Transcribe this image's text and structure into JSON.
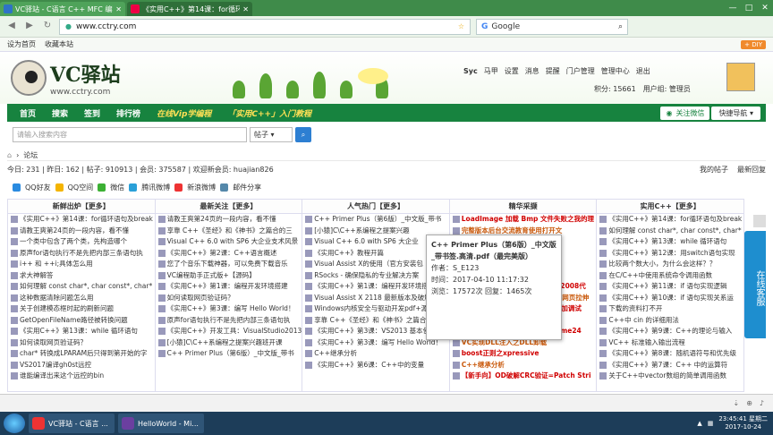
{
  "browser": {
    "tabs": [
      {
        "title": "VC驿站 - C语言 C++ MFC 编程"
      },
      {
        "title": "《实用C++》第14课：for循环语句"
      }
    ],
    "url": "www.cctry.com",
    "search_engine": "Google",
    "bookmarks": [
      "设为首页",
      "收藏本站"
    ],
    "diy_label": "DIY"
  },
  "site": {
    "logo_name": "VC驿站",
    "logo_url": "www.cctry.com",
    "user": {
      "name": "Syc",
      "links": [
        "马甲",
        "设置",
        "消息",
        "提醒",
        "门户管理",
        "管理中心",
        "退出"
      ],
      "credit": "积分: 15661",
      "group": "用户组: 管理员"
    },
    "menu": [
      "首页",
      "搜索",
      "签到",
      "排行榜",
      "在线Vip学编程",
      "「实用C++」入门教程"
    ],
    "wechat": "关注微信",
    "quicknav": "快捷导航",
    "search": {
      "placeholder": "请输入搜索内容",
      "select": "帖子"
    },
    "crumb": "论坛",
    "stats": "今日: 231 | 昨日: 162 | 帖子: 910913 | 会员: 375587 | 欢迎新会员: huajian826",
    "stats_right": [
      "我的帖子",
      "最新回复"
    ],
    "share": [
      "QQ好友",
      "QQ空间",
      "微信",
      "腾讯微博",
      "新浪微博",
      "邮件分享"
    ],
    "columns": [
      {
        "head": "新鲜出炉【更多】",
        "items": [
          "《实用C++》第14课：for循环语句及break",
          "请教王爽第24页的一段内容，看不懂",
          "一个类中包含了两个类，先构造哪个",
          "原声for语句执行不是先把内部三条语句执",
          "i++ 和 ++i;具体怎么用",
          "求大神解答",
          "如何理解 const char*, char const*, char*",
          "这种数据清除问题怎么用",
          "关于创建模态框时起的刷新问题",
          "GetOpenFileName路径被转换问题",
          "《实用C++》第13课：while 循环语句",
          "如何读取网页验证码？",
          "char* 转换成LPARAM后只得到第开始的字",
          "VS2017编译gh0st远控",
          "谁能编译出来这个远控的bin"
        ]
      },
      {
        "head": "最新关注【更多】",
        "items": [
          "请教王爽第24页的一段内容，看不懂",
          "享靠 C++《圣经》和《神书》之篇合的三",
          "Visual C++ 6.0 with SP6 大企业支术风景",
          "《实用C++》第2课：C++语言概述",
          "您了个音乐下载神器，可以免费下载音乐",
          "VC编程助手正式版+【源码】",
          "《实用C++》第1课：编程开发环境搭建",
          "如何读取网页验证码？",
          "《实用C++》第3课：编写 Hello World！",
          "原声for语句执行不是先把内部三条语句执",
          "《实用C++》开发工具：VisualStudio2013",
          "[小猿]C\\C++系编程之提案兴趣班开课",
          "C++ Primer Plus（第6版）_中文版_带书",
          "",
          ""
        ]
      },
      {
        "head": "人气热门【更多】",
        "items": [
          "C++ Primer Plus（第6版）_中文版_带书",
          "[小猿]C\\C++系编程之提案兴趣",
          "Visual C++ 6.0 with SP6 大企业",
          "《实用C++》教程开篇",
          "Visual Assist X的使用（官方安装包",
          "RSocks - 确保隐私的专业解决方案",
          "《实用C++》第1课：编程开发环境搭建",
          "Visual Assist X 2118 最新版本及破解补丁",
          "Windows内核安全与驱动开发pdf+源码 请",
          "享靠 C++《圣经》和《神书》之篇合的三",
          "《实用C++》第3课：VS2013 基本使用",
          "《实用C++》第3课：编写 Hello World！",
          "C++继承分析",
          "《实用C++》第6课：C++中的变量",
          ""
        ]
      },
      {
        "head": "精华采撷",
        "items": [
          "LoadImage 加载 Bmp 文件失败之我的理",
          "完整版本后台交流教育使用打开文",
          "",
          "",
          "",
          "",
          "ODBC 存储/读取 图像数据（VC2008代",
          "【复习】从调试计器讲检（计算器网页拉伸",
          "VC实现【API钩取】【调试法】附加调试",
          "VC实现DLL注入之DLL卸载",
          "【OD反汇编】【逗比向】-Crackme24",
          "VC实现DLL注入之DLL卸载",
          "boost正则之xpressive",
          "C++继承分析",
          "【新手向】OD破解CRC验证=Patch Stri"
        ]
      },
      {
        "head": "实用C++【更多】",
        "items": [
          "《实用C++》第14课：for循环语句及break",
          "如何理解 const char*, char const*, char*",
          "《实用C++》第13课：while 循环语句",
          "《实用C++》第12课：用switch语句实现",
          "比较两个数大小，为什么会这样？？",
          "在C/C++中使用系统命令调用函数",
          "《实用C++》第11课：if 语句实现逻辑",
          "《实用C++》第10课：if 语句实现关系运",
          "下载的资料打不开",
          "C++中 cin 的详细用法",
          "《实用C++》第9课：C++的理论与输入",
          "VC++ 标准输入输出流程",
          "《实用C++》第8课：随机语符号和优先级",
          "《实用C++》第7课：C++ 中的运算符",
          "关于C++中vector数组的简单调用函数"
        ]
      }
    ],
    "tooltip": {
      "title": "C++ Primer Plus（第6版）_中文版_带书签.高清.pdf（最完美版）",
      "author": "作者：S_E123",
      "time": "时间：2017-04-10 11:17:32",
      "views": "浏览：17572次  回复：1465次"
    },
    "side_panel": "在线客服"
  },
  "taskbar": {
    "items": [
      "VC驿站 - C语言 ...",
      "HelloWorld - Mi..."
    ],
    "time": "23:45:41 星期二",
    "date": "2017-10-24"
  },
  "colors": {
    "menu_green": "#17833f",
    "accent_blue": "#1e8ecf",
    "highlight_red": "#d00000"
  }
}
